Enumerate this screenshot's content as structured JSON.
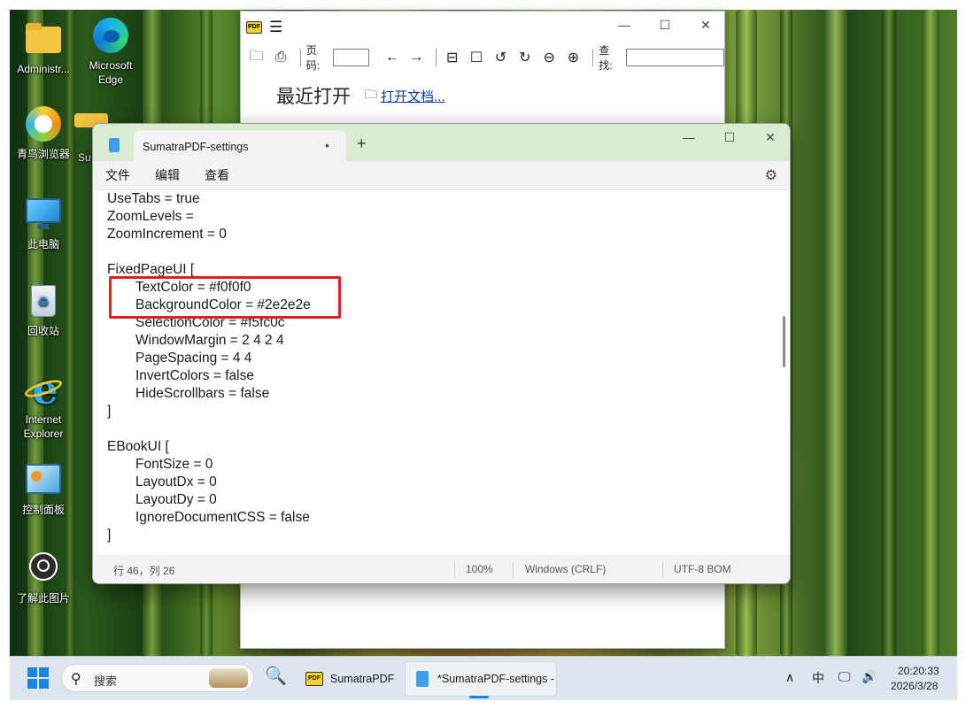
{
  "desktop_icons": [
    {
      "name": "folder-icon",
      "label": "Administr..."
    },
    {
      "name": "edge-icon",
      "label": "Microsoft Edge"
    },
    {
      "name": "browser-icon",
      "label": "青鸟浏览器"
    },
    {
      "name": "folder-icon-2",
      "label": "Su"
    },
    {
      "name": "computer-icon",
      "label": "此电脑"
    },
    {
      "name": "recycle-bin-icon",
      "label": "回收站"
    },
    {
      "name": "ie-icon",
      "label": "Internet Explorer"
    },
    {
      "name": "control-panel-icon",
      "label": "控制面板"
    },
    {
      "name": "picture-info-icon",
      "label": "了解此图片"
    }
  ],
  "pdf_window": {
    "page_label": "页码:",
    "find_label": "查找:",
    "recent_label": "最近打开",
    "open_doc_label": "打开文档..."
  },
  "notepad": {
    "tab_title": "SumatraPDF-settings",
    "menu": {
      "file": "文件",
      "edit": "编辑",
      "view": "查看"
    },
    "lines": [
      "UseTabs = true",
      "ZoomLevels =",
      "ZoomIncrement = 0",
      "",
      "FixedPageUI [",
      "\tTextColor = #f0f0f0",
      "\tBackgroundColor = #2e2e2e",
      "\tSelectionColor = #f5fc0c",
      "\tWindowMargin = 2 4 2 4",
      "\tPageSpacing = 4 4",
      "\tInvertColors = false",
      "\tHideScrollbars = false",
      "]",
      "",
      "EBookUI [",
      "\tFontSize = 0",
      "\tLayoutDx = 0",
      "\tLayoutDy = 0",
      "\tIgnoreDocumentCSS = false",
      "]"
    ],
    "status": {
      "position": "行 46，列 26",
      "zoom": "100%",
      "line_ending": "Windows (CRLF)",
      "encoding": "UTF-8 BOM"
    }
  },
  "taskbar": {
    "search_placeholder": "搜索",
    "apps": [
      {
        "name": "sumatrapdf",
        "label": "SumatraPDF"
      },
      {
        "name": "notepad",
        "label": "*SumatraPDF-settings -"
      }
    ],
    "ime": "中",
    "time": "20:20:33",
    "date": "2026/3/28"
  },
  "colors": {
    "highlight_box": "#e0201c",
    "notepad_titlebar": "#d9ecd2",
    "taskbar": "#dde6ee"
  }
}
